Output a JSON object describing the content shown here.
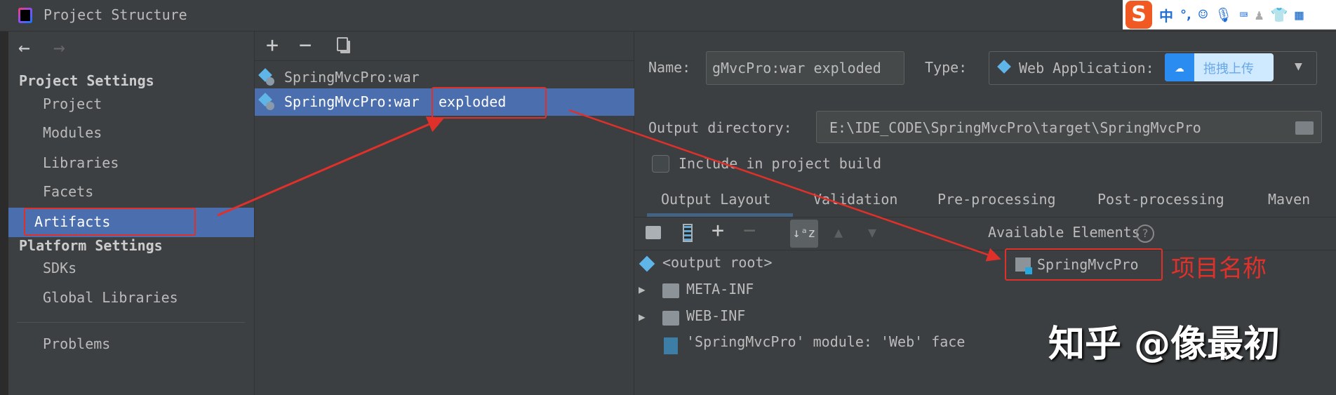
{
  "window": {
    "title": "Project Structure"
  },
  "sidebar": {
    "project_settings_header": "Project Settings",
    "project_items": [
      "Project",
      "Modules",
      "Libraries",
      "Facets",
      "Artifacts"
    ],
    "platform_settings_header": "Platform Settings",
    "platform_items": [
      "SDKs",
      "Global Libraries"
    ],
    "problems": "Problems",
    "selected": "Artifacts"
  },
  "artifacts": {
    "items": [
      {
        "label": "SpringMvcPro:war"
      },
      {
        "label_main": "SpringMvcPro:war",
        "label_suffix": "exploded",
        "selected": true
      }
    ]
  },
  "details": {
    "name_label": "Name:",
    "name_value": "gMvcPro:war exploded",
    "type_label": "Type:",
    "type_value": "Web Application:",
    "upload_button": "拖拽上传",
    "output_dir_label": "Output directory:",
    "output_dir_value": "E:\\IDE_CODE\\SpringMvcPro\\target\\SpringMvcPro",
    "include_label": "Include in project build",
    "include_checked": false,
    "tabs": [
      "Output Layout",
      "Validation",
      "Pre-processing",
      "Post-processing",
      "Maven"
    ],
    "active_tab": "Output Layout",
    "available_elements": "Available Elements",
    "available_item": "SpringMvcPro",
    "tree": [
      "<output root>",
      "META-INF",
      "WEB-INF",
      "'SpringMvcPro' module: 'Web' face"
    ]
  },
  "annotations": {
    "project_name": "项目名称",
    "watermark": "知乎 @像最初"
  },
  "ime": {
    "lang": "中",
    "punct": "°,"
  },
  "colors": {
    "selection": "#4b6eaf",
    "annotation": "#e0302a",
    "background": "#3c3f41"
  }
}
